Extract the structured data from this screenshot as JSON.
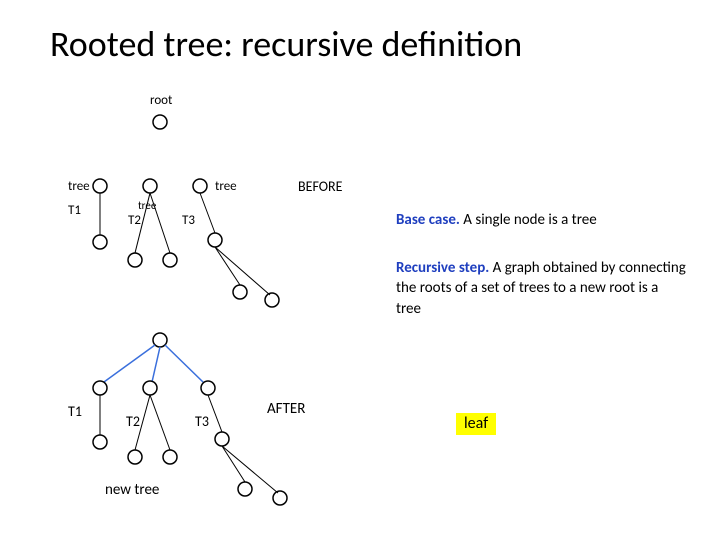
{
  "title": "Rooted tree: recursive definition",
  "labels": {
    "root": "root",
    "tree_left": "tree",
    "tree_mid_small": "tree",
    "tree_right": "tree",
    "t1": "T1",
    "t2": "T2",
    "t3": "T3",
    "before": "BEFORE",
    "after": "AFTER",
    "t1b": "T1",
    "t2b": "T2",
    "t3b": "T3",
    "new_tree": "new tree"
  },
  "base_case": {
    "heading": "Base case.",
    "text": " A single node is a tree"
  },
  "recursive_step": {
    "heading": "Recursive step.",
    "text": " A graph obtained by connecting the roots of a set of trees to a new root is a tree"
  },
  "leaf": "leaf"
}
